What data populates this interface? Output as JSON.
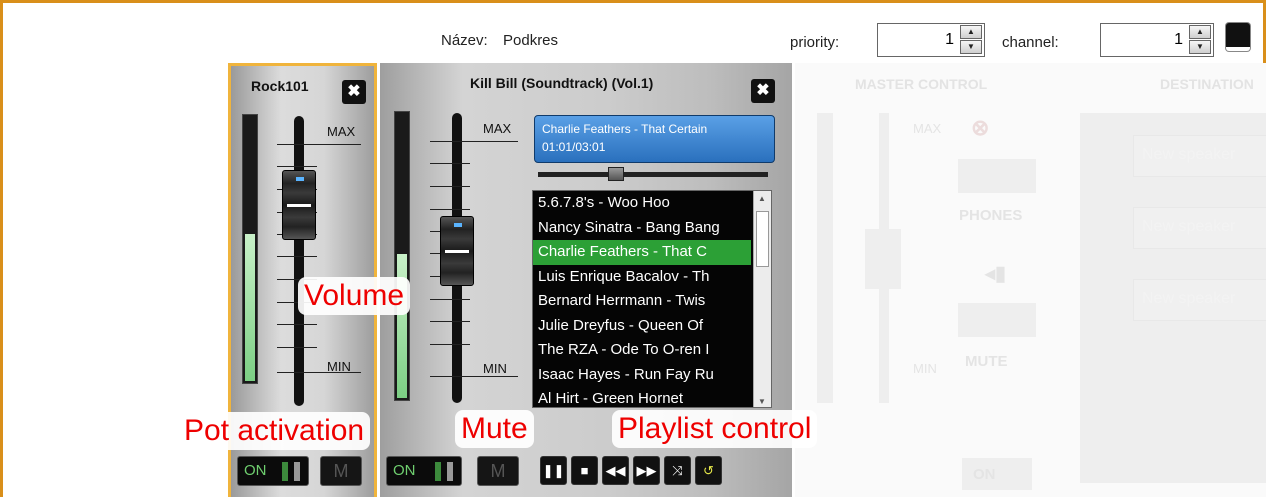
{
  "header": {
    "name_label": "Název:",
    "name_value": "Podkres",
    "priority_label": "priority:",
    "priority_value": "1",
    "channel_label": "channel:",
    "channel_value": "1"
  },
  "pot1": {
    "title": "Rock101",
    "close": "✖",
    "scale_max": "MAX",
    "scale_min": "MIN",
    "level": 0.55,
    "on_label": "ON",
    "mute_label": "M"
  },
  "pot2": {
    "title": "Kill Bill (Soundtrack) (Vol.1)",
    "close": "✖",
    "scale_max": "MAX",
    "scale_min": "MIN",
    "level": 0.5,
    "now_playing": "Charlie Feathers - That Certain",
    "time": "01:01/03:01",
    "playlist": [
      "5.6.7.8's - Woo Hoo",
      "Nancy Sinatra - Bang Bang",
      "Charlie Feathers - That C",
      "Luis Enrique Bacalov - Th",
      "Bernard Herrmann - Twis",
      "Julie Dreyfus - Queen Of",
      "The RZA - Ode To O-ren I",
      "Isaac Hayes - Run Fay Ru",
      "Al Hirt - Green Hornet"
    ],
    "selected_index": 2,
    "on_label": "ON",
    "mute_label": "M",
    "controls": [
      "pause-icon",
      "stop-icon",
      "rewind-icon",
      "fast-forward-icon",
      "shuffle-icon",
      "repeat-icon"
    ]
  },
  "master": {
    "title": "MASTER CONTROL",
    "phones_label": "PHONES",
    "mute_label": "MUTE",
    "scale_max": "MAX",
    "scale_min": "MIN",
    "on_label": "ON"
  },
  "destination": {
    "title": "DESTINATION",
    "speakers": [
      "New speaker",
      "New speaker",
      "New speaker"
    ]
  },
  "annotations": {
    "volume": "Volume",
    "pot_activation": "Pot activation",
    "mute": "Mute",
    "playlist_control": "Playlist control"
  },
  "colors": {
    "frame": "#d98f1a",
    "selected": "#2ca036",
    "nowplaying": "#2a70bd",
    "annotation": "#e00000"
  }
}
